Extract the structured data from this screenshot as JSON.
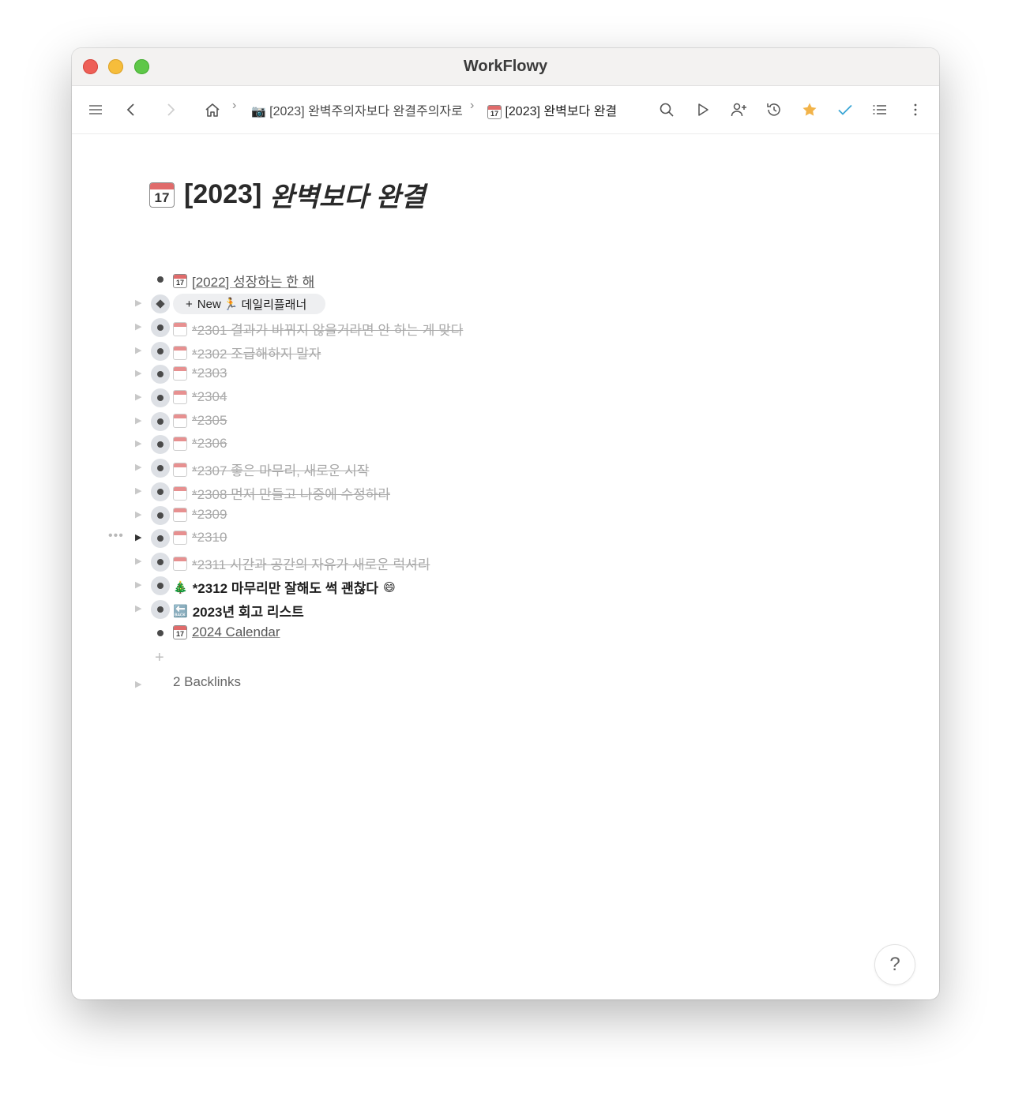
{
  "window": {
    "title": "WorkFlowy"
  },
  "breadcrumbs": [
    {
      "icon": "📷",
      "label": "[2023] 완벽주의자보다 완결주의자로"
    },
    {
      "icon": "📆",
      "label": "[2023] 완벽보다 완결"
    }
  ],
  "page": {
    "title_prefix": "[2023]",
    "title_rest": "완벽보다 완결",
    "cal_num": "17"
  },
  "items": [
    {
      "label": "[2022] 성장하는 한 해"
    },
    {
      "chip_plus": "+",
      "chip_new": "New",
      "chip_icon": "🏃",
      "chip_label": "데일리플래너"
    },
    {
      "label": "*2301 결과가 바뀌지 않을거라면 안 하는 게 맞다"
    },
    {
      "label": "*2302  조급해하지 말자"
    },
    {
      "label": "*2303"
    },
    {
      "label": "*2304"
    },
    {
      "label": "*2305"
    },
    {
      "label": "*2306"
    },
    {
      "label": "*2307 좋은 마무리, 새로운 시작"
    },
    {
      "label": "*2308 먼저 만들고 나중에 수정하라"
    },
    {
      "label": "*2309"
    },
    {
      "label": "*2310"
    },
    {
      "label": " *2311 시간과 공간의 자유가 새로운 럭셔리"
    },
    {
      "icon": "🎄",
      "label": "*2312 마무리만 잘해도 썩 괜찮다",
      "suffix": "😄"
    },
    {
      "icon": "🔙",
      "label": "2023년 회고 리스트"
    },
    {
      "label": "2024 Calendar "
    }
  ],
  "backlinks": {
    "label": "2 Backlinks"
  },
  "help": {
    "label": "?"
  },
  "colors": {
    "star": "#f2b349",
    "check": "#3aa6d6",
    "done_text": "#a9a9a9"
  }
}
